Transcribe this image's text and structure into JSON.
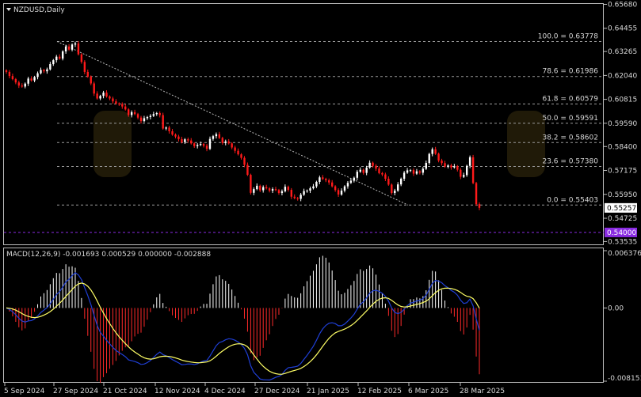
{
  "window": {
    "title": "NZDUSD,Daily"
  },
  "colors": {
    "background": "#000000",
    "grid": "#9a9a9a",
    "bull": "#ffffff",
    "bear": "#ff1a1a",
    "macd_main": "#1f3fd6",
    "macd_signal": "#ffff66",
    "hist_pos": "#ffffff",
    "hist_neg": "#ff2a2a",
    "level_line": "#8a2be2",
    "current_price_box": "#ffffff"
  },
  "price_axis": {
    "labels": [
      "0.65680",
      "0.64455",
      "0.63265",
      "0.62040",
      "0.60815",
      "0.59590",
      "0.58400",
      "0.57175",
      "0.55950",
      "0.54725",
      "0.53535"
    ],
    "current_price": "0.55257",
    "level_price": "0.54000"
  },
  "fibonacci": {
    "levels": [
      {
        "label": "100.0 = 0.63778",
        "price": 0.63778
      },
      {
        "label": "78.6 = 0.61986",
        "price": 0.61986
      },
      {
        "label": "61.8 = 0.60579",
        "price": 0.60579
      },
      {
        "label": "50.0 = 0.59591",
        "price": 0.59591
      },
      {
        "label": "38.2 = 0.58602",
        "price": 0.58602
      },
      {
        "label": "23.6 = 0.57380",
        "price": 0.5738
      },
      {
        "label": "0.0 = 0.55403",
        "price": 0.55403
      }
    ]
  },
  "time_axis": {
    "labels": [
      "5 Sep 2024",
      "27 Sep 2024",
      "21 Oct 2024",
      "12 Nov 2024",
      "4 Dec 2024",
      "27 Dec 2024",
      "21 Jan 2025",
      "12 Feb 2025",
      "6 Mar 2025",
      "28 Mar 2025"
    ]
  },
  "macd": {
    "title": "MACD(12,26,9) -0.001693 0.000529 0.000000 -0.002888",
    "axis_labels": [
      "0.006376",
      "0.00",
      "-0.008151"
    ]
  },
  "chart_data": {
    "type": "candlestick",
    "symbol": "NZDUSD",
    "timeframe": "Daily",
    "ylim": [
      0.5343,
      0.6574
    ],
    "closes": [
      0.6222,
      0.6201,
      0.6185,
      0.6168,
      0.6152,
      0.6147,
      0.6162,
      0.6188,
      0.6178,
      0.6196,
      0.6215,
      0.6232,
      0.6225,
      0.6235,
      0.6262,
      0.6282,
      0.63,
      0.629,
      0.6327,
      0.6352,
      0.6336,
      0.6362,
      0.6368,
      0.6312,
      0.6273,
      0.6222,
      0.6198,
      0.6163,
      0.6111,
      0.6086,
      0.6099,
      0.6116,
      0.6096,
      0.6086,
      0.6071,
      0.606,
      0.6057,
      0.6045,
      0.603,
      0.6001,
      0.6016,
      0.6006,
      0.5988,
      0.597,
      0.5985,
      0.5991,
      0.5997,
      0.6006,
      0.6011,
      0.6001,
      0.5932,
      0.5937,
      0.5918,
      0.5901,
      0.5891,
      0.5878,
      0.5862,
      0.5877,
      0.5871,
      0.5856,
      0.5842,
      0.5848,
      0.5853,
      0.5844,
      0.5828,
      0.5879,
      0.5893,
      0.5903,
      0.5884,
      0.5858,
      0.5866,
      0.5856,
      0.5835,
      0.5818,
      0.58,
      0.5782,
      0.5746,
      0.5695,
      0.5603,
      0.5622,
      0.5639,
      0.5616,
      0.5632,
      0.5626,
      0.5614,
      0.5622,
      0.5617,
      0.5602,
      0.5611,
      0.5634,
      0.5618,
      0.5583,
      0.5576,
      0.5572,
      0.5593,
      0.5612,
      0.5614,
      0.5626,
      0.5636,
      0.5659,
      0.5682,
      0.5674,
      0.5667,
      0.5656,
      0.5636,
      0.5617,
      0.5594,
      0.5614,
      0.5636,
      0.5654,
      0.5665,
      0.568,
      0.5711,
      0.5721,
      0.5705,
      0.5732,
      0.5757,
      0.5741,
      0.5727,
      0.5704,
      0.5697,
      0.5675,
      0.5645,
      0.5602,
      0.5614,
      0.5646,
      0.5675,
      0.5706,
      0.5718,
      0.5719,
      0.5701,
      0.5713,
      0.5706,
      0.5726,
      0.5756,
      0.5802,
      0.5826,
      0.5803,
      0.5768,
      0.5755,
      0.5737,
      0.5743,
      0.5733,
      0.5739,
      0.5721,
      0.5685,
      0.5694,
      0.5741,
      0.5785,
      0.5653,
      0.5545,
      0.5526
    ]
  }
}
